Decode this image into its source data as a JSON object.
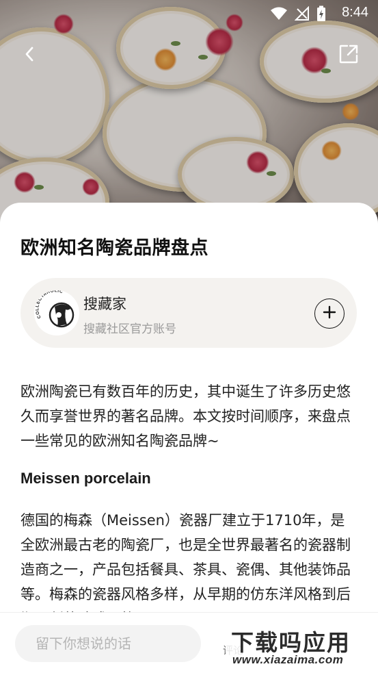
{
  "status_bar": {
    "time": "8:44",
    "icons": [
      "wifi-icon",
      "no-signal-icon",
      "battery-charging-icon"
    ]
  },
  "header": {
    "back_icon": "chevron-left-icon",
    "share_icon": "external-link-icon"
  },
  "article": {
    "title": "欧洲知名陶瓷品牌盘点",
    "intro": "欧洲陶瓷已有数百年的历史，其中诞生了许多历史悠久而享誉世界的著名品牌。本文按时间顺序，来盘点一些常见的欧洲知名陶瓷品牌~",
    "section_title": "Meissen porcelain",
    "section_body": "德国的梅森（Meissen）瓷器厂建立于1710年，是全欧洲最古老的陶瓷厂，也是全世界最著名的瓷器制造商之一，产品包括餐具、茶具、瓷偶、其他装饰品等。梅森的瓷器风格多样，从早期的仿东洋风格到后期开创的欧式风格"
  },
  "author": {
    "name": "搜藏家",
    "description": "搜藏社区官方账号",
    "logo_text": "COLLECTAHOLIC",
    "follow_icon": "plus-icon"
  },
  "comment_bar": {
    "placeholder": "留下你想说的话",
    "action_label": "评论"
  },
  "watermark": {
    "main": "下载吗应用",
    "sub": "www.xiazaima.com"
  },
  "colors": {
    "card_bg": "#f4f2ef",
    "text_primary": "#111111",
    "text_secondary": "#9a9a9a"
  }
}
